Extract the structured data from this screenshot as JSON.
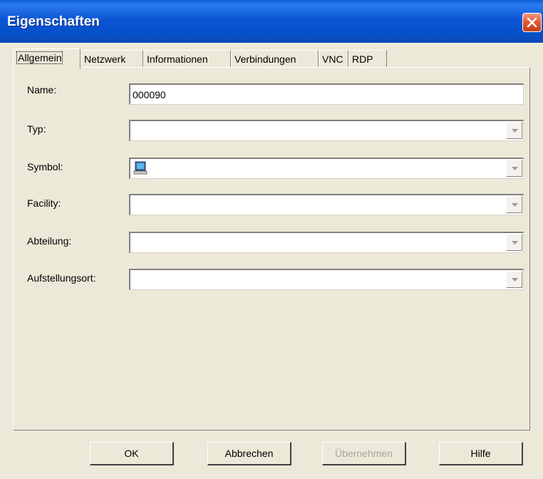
{
  "window": {
    "title": "Eigenschaften"
  },
  "tabs": [
    {
      "label": "Allgemein"
    },
    {
      "label": "Netzwerk"
    },
    {
      "label": "Informationen"
    },
    {
      "label": "Verbindungen"
    },
    {
      "label": "VNC"
    },
    {
      "label": "RDP"
    }
  ],
  "form": {
    "name": {
      "label": "Name:",
      "value": "000090"
    },
    "typ": {
      "label": "Typ:",
      "value": ""
    },
    "symbol": {
      "label": "Symbol:",
      "value": "",
      "icon": "computer-icon"
    },
    "facility": {
      "label": "Facility:",
      "value": ""
    },
    "abteilung": {
      "label": "Abteilung:",
      "value": ""
    },
    "aufstellungsort": {
      "label": "Aufstellungsort:",
      "value": ""
    }
  },
  "buttons": {
    "ok": "OK",
    "cancel": "Abbrechen",
    "apply": "Übernehmen",
    "help": "Hilfe"
  }
}
